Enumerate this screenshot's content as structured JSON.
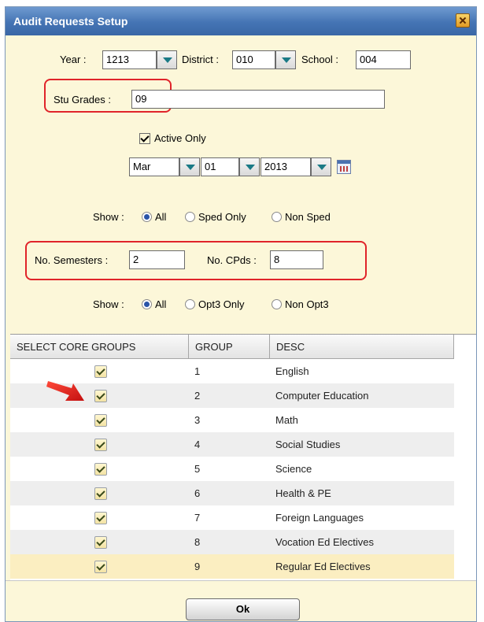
{
  "window": {
    "title": "Audit Requests Setup"
  },
  "filters": {
    "year_label": "Year :",
    "year_value": "1213",
    "district_label": "District :",
    "district_value": "010",
    "school_label": "School :",
    "school_value": "004",
    "stu_grades_label": "Stu Grades :",
    "stu_grades_value": "09",
    "active_only_label": "Active Only",
    "date": {
      "month": "Mar",
      "day": "01",
      "year": "2013"
    }
  },
  "show_sped": {
    "label": "Show :",
    "options": [
      "All",
      "Sped Only",
      "Non Sped"
    ],
    "selected": "All"
  },
  "semesters": {
    "label": "No. Semesters :",
    "value": "2",
    "cpds_label": "No. CPds :",
    "cpds_value": "8"
  },
  "show_opt3": {
    "label": "Show :",
    "options": [
      "All",
      "Opt3 Only",
      "Non Opt3"
    ],
    "selected": "All"
  },
  "grid": {
    "headers": [
      "SELECT CORE GROUPS",
      "GROUP",
      "DESC"
    ],
    "rows": [
      {
        "group": "1",
        "desc": "English"
      },
      {
        "group": "2",
        "desc": "Computer Education"
      },
      {
        "group": "3",
        "desc": "Math"
      },
      {
        "group": "4",
        "desc": "Social Studies"
      },
      {
        "group": "5",
        "desc": "Science"
      },
      {
        "group": "6",
        "desc": "Health & PE"
      },
      {
        "group": "7",
        "desc": "Foreign Languages"
      },
      {
        "group": "8",
        "desc": "Vocation Ed Electives"
      },
      {
        "group": "9",
        "desc": "Regular Ed Electives"
      }
    ]
  },
  "footer": {
    "ok_label": "Ok"
  },
  "colors": {
    "title_bar": "#4474b4",
    "panel": "#fcf7d9",
    "highlight": "#e0242a",
    "selected_row": "#fbeec1"
  }
}
